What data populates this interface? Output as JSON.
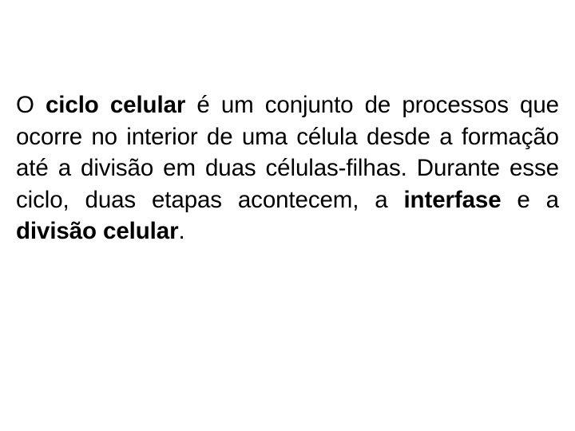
{
  "document": {
    "type": "slide",
    "background_color": "#ffffff",
    "text_color": "#000000",
    "paragraph": {
      "full_text": "O ciclo celular é um conjunto de processos que ocorre no interior de uma célula desde a formação até a divisão em duas células-filhas. Durante esse ciclo, duas etapas acontecem, a interfase e a divisão celular.",
      "alignment": "justify",
      "lines": [
        {
          "id": "line-1",
          "last": false,
          "segments": [
            {
              "text": "O",
              "bold": false
            },
            {
              "text": "ciclo",
              "bold": true
            },
            {
              "text": "celular",
              "bold": true
            },
            {
              "text": "é",
              "bold": false
            },
            {
              "text": "um",
              "bold": false
            },
            {
              "text": "conjunto",
              "bold": false
            },
            {
              "text": "de",
              "bold": false
            },
            {
              "text": "processos",
              "bold": false
            },
            {
              "text": "que",
              "bold": false
            }
          ]
        },
        {
          "id": "line-2",
          "last": false,
          "segments": [
            {
              "text": "ocorre",
              "bold": false
            },
            {
              "text": "no",
              "bold": false
            },
            {
              "text": "interior",
              "bold": false
            },
            {
              "text": "de",
              "bold": false
            },
            {
              "text": "uma",
              "bold": false
            },
            {
              "text": "célula",
              "bold": false
            },
            {
              "text": "desde",
              "bold": false
            },
            {
              "text": "a",
              "bold": false
            },
            {
              "text": "formação",
              "bold": false
            }
          ]
        },
        {
          "id": "line-3",
          "last": false,
          "segments": [
            {
              "text": "até",
              "bold": false
            },
            {
              "text": "a",
              "bold": false
            },
            {
              "text": "divisão",
              "bold": false
            },
            {
              "text": "em",
              "bold": false
            },
            {
              "text": "duas",
              "bold": false
            },
            {
              "text": "células-filhas.",
              "bold": false
            },
            {
              "text": "Durante",
              "bold": false
            },
            {
              "text": "esse",
              "bold": false
            }
          ]
        },
        {
          "id": "line-4",
          "last": false,
          "segments": [
            {
              "text": "ciclo,",
              "bold": false
            },
            {
              "text": "duas",
              "bold": false
            },
            {
              "text": "etapas",
              "bold": false
            },
            {
              "text": "acontecem,",
              "bold": false
            },
            {
              "text": "a",
              "bold": false
            },
            {
              "text": "interfase",
              "bold": true
            },
            {
              "text": "e",
              "bold": false
            },
            {
              "text": "a",
              "bold": false
            }
          ]
        },
        {
          "id": "line-5",
          "last": true,
          "segments": [
            {
              "text": "divisão celular",
              "bold": true
            },
            {
              "text": ".",
              "bold": false
            }
          ]
        }
      ]
    }
  }
}
